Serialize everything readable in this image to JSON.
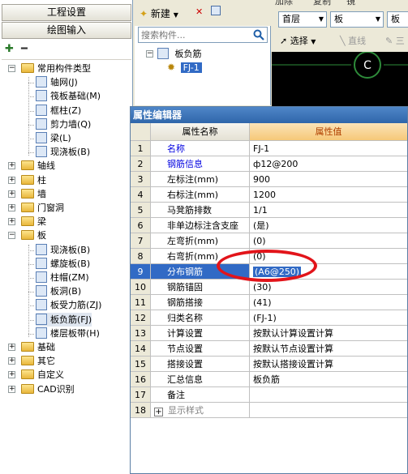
{
  "left_panel": {
    "project_settings": "工程设置",
    "drawing_input": "绘图输入",
    "tree": [
      {
        "label": "常用构件类型",
        "level": 0,
        "expanded": true,
        "type": "folder"
      },
      {
        "label": "轴网(J)",
        "level": 1,
        "type": "item"
      },
      {
        "label": "筏板基础(M)",
        "level": 1,
        "type": "item"
      },
      {
        "label": "框柱(Z)",
        "level": 1,
        "type": "item"
      },
      {
        "label": "剪力墙(Q)",
        "level": 1,
        "type": "item"
      },
      {
        "label": "梁(L)",
        "level": 1,
        "type": "item"
      },
      {
        "label": "现浇板(B)",
        "level": 1,
        "type": "item"
      },
      {
        "label": "轴线",
        "level": 0,
        "expanded": false,
        "type": "folder"
      },
      {
        "label": "柱",
        "level": 0,
        "expanded": false,
        "type": "folder"
      },
      {
        "label": "墙",
        "level": 0,
        "expanded": false,
        "type": "folder"
      },
      {
        "label": "门窗洞",
        "level": 0,
        "expanded": false,
        "type": "folder"
      },
      {
        "label": "梁",
        "level": 0,
        "expanded": false,
        "type": "folder"
      },
      {
        "label": "板",
        "level": 0,
        "expanded": true,
        "type": "folder"
      },
      {
        "label": "现浇板(B)",
        "level": 1,
        "type": "item"
      },
      {
        "label": "螺旋板(B)",
        "level": 1,
        "type": "item"
      },
      {
        "label": "柱帽(ZM)",
        "level": 1,
        "type": "item"
      },
      {
        "label": "板洞(B)",
        "level": 1,
        "type": "item"
      },
      {
        "label": "板受力筋(ZJ)",
        "level": 1,
        "type": "item"
      },
      {
        "label": "板负筋(FJ)",
        "level": 1,
        "type": "item",
        "selected": true
      },
      {
        "label": "楼层板带(H)",
        "level": 1,
        "type": "item"
      },
      {
        "label": "基础",
        "level": 0,
        "expanded": false,
        "type": "folder"
      },
      {
        "label": "其它",
        "level": 0,
        "expanded": false,
        "type": "folder"
      },
      {
        "label": "自定义",
        "level": 0,
        "expanded": false,
        "type": "folder"
      },
      {
        "label": "CAD识别",
        "level": 0,
        "expanded": false,
        "type": "folder"
      }
    ]
  },
  "mid_panel": {
    "new_label": "新建",
    "search_placeholder": "搜索构件...",
    "group_label": "板负筋",
    "item_label": "FJ-1"
  },
  "right_panel": {
    "top_partial": [
      "加除",
      "复制",
      "镜"
    ],
    "floor_select": "首层",
    "type_select": "板",
    "extra_select": "板",
    "select_label": "选择",
    "line_label": "直线",
    "point_label": "三",
    "canvas_label": "C"
  },
  "prop_editor": {
    "title": "属性编辑器",
    "col_name": "属性名称",
    "col_value": "属性值",
    "rows": [
      {
        "num": "1",
        "name": "名称",
        "value": "FJ-1",
        "name_style": "blue"
      },
      {
        "num": "2",
        "name": "钢筋信息",
        "value": "ф12@200",
        "name_style": "blue"
      },
      {
        "num": "3",
        "name": "左标注(mm)",
        "value": "900",
        "name_style": ""
      },
      {
        "num": "4",
        "name": "右标注(mm)",
        "value": "1200",
        "name_style": ""
      },
      {
        "num": "5",
        "name": "马凳筋排数",
        "value": "1/1",
        "name_style": ""
      },
      {
        "num": "6",
        "name": "非单边标注含支座",
        "value": "(是)",
        "name_style": ""
      },
      {
        "num": "7",
        "name": "左弯折(mm)",
        "value": "(0)",
        "name_style": ""
      },
      {
        "num": "8",
        "name": "右弯折(mm)",
        "value": "(0)",
        "name_style": ""
      },
      {
        "num": "9",
        "name": "分布钢筋",
        "value": "(A6@250)",
        "name_style": "",
        "selected": true
      },
      {
        "num": "10",
        "name": "钢筋锚固",
        "value": "(30)",
        "name_style": ""
      },
      {
        "num": "11",
        "name": "钢筋搭接",
        "value": "(41)",
        "name_style": ""
      },
      {
        "num": "12",
        "name": "归类名称",
        "value": "(FJ-1)",
        "name_style": ""
      },
      {
        "num": "13",
        "name": "计算设置",
        "value": "按默认计算设置计算",
        "name_style": ""
      },
      {
        "num": "14",
        "name": "节点设置",
        "value": "按默认节点设置计算",
        "name_style": ""
      },
      {
        "num": "15",
        "name": "搭接设置",
        "value": "按默认搭接设置计算",
        "name_style": ""
      },
      {
        "num": "16",
        "name": "汇总信息",
        "value": "板负筋",
        "name_style": ""
      },
      {
        "num": "17",
        "name": "备注",
        "value": "",
        "name_style": ""
      },
      {
        "num": "18",
        "name": "显示样式",
        "value": "",
        "name_style": "gray",
        "expandable": true
      }
    ]
  }
}
